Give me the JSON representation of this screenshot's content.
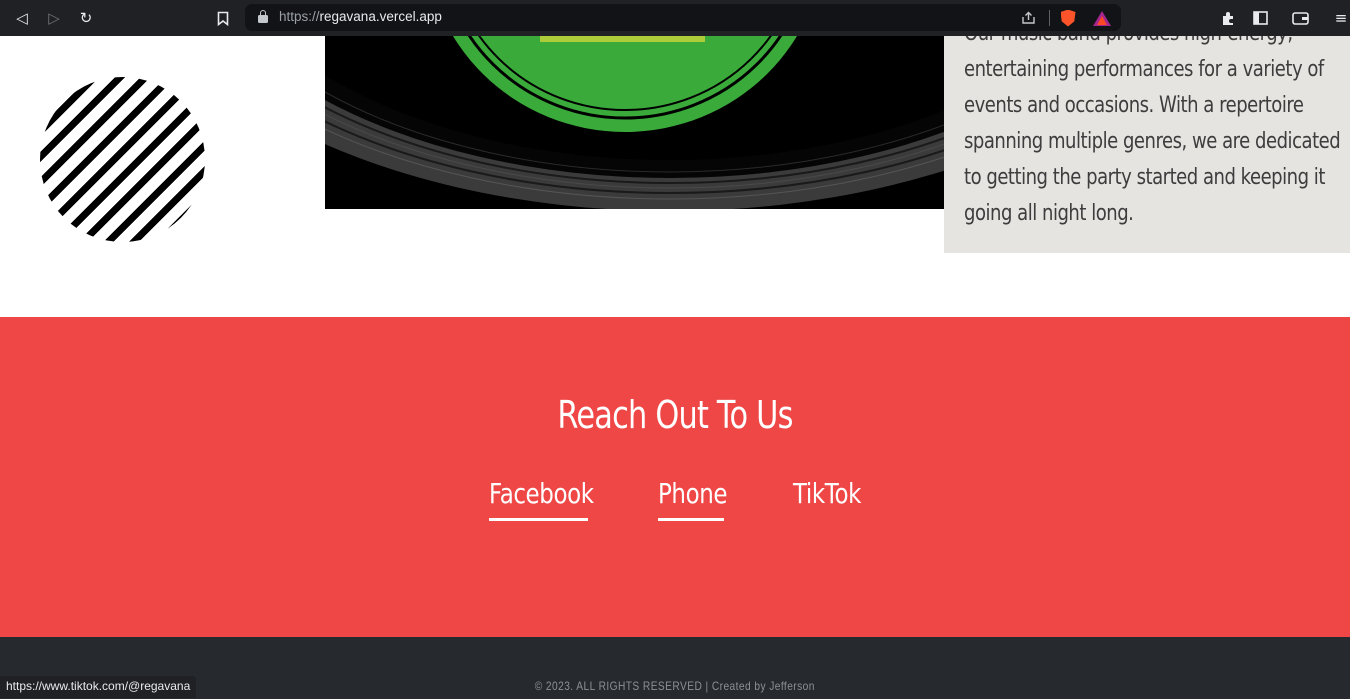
{
  "browser": {
    "url_scheme": "https://",
    "url_host": "regavana.vercel.app",
    "status_url": "https://www.tiktok.com/@regavana"
  },
  "about": {
    "text": "Our music band provides high-energy, entertaining performances for a variety of events and occasions. With a repertoire spanning multiple genres, we are dedicated to getting the party started and keeping it going all night long."
  },
  "contact": {
    "title": "Reach Out To Us",
    "links": [
      {
        "label": "Facebook"
      },
      {
        "label": "Phone"
      },
      {
        "label": "TikTok"
      }
    ]
  },
  "footer": {
    "text": "© 2023. ALL RIGHTS RESERVED | Created by Jefferson"
  },
  "colors": {
    "contact_bg": "#ef4646",
    "footer_bg": "#26292d",
    "about_bg": "#e6e4e1",
    "vinyl_label": "#3aaa3a"
  }
}
